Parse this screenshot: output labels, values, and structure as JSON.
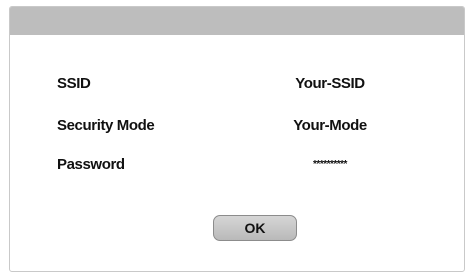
{
  "dialog": {
    "title": "",
    "fields": [
      {
        "label": "SSID",
        "value": "Your-SSID"
      },
      {
        "label": "Security Mode",
        "value": "Your-Mode"
      },
      {
        "label": "Password",
        "value": "**********"
      }
    ],
    "ok_label": "OK"
  }
}
